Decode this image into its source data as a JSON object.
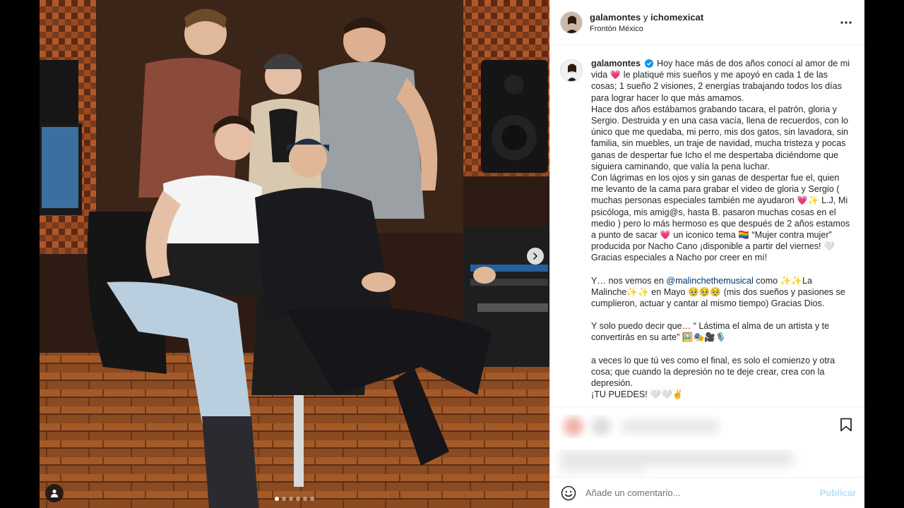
{
  "post": {
    "header": {
      "author": "galamontes",
      "joiner": "y",
      "coauthor": "ichomexicat",
      "location": "Frontón México"
    },
    "caption": {
      "username": "galamontes",
      "lines": [
        "Hoy hace más de dos años conocí al amor de mi vida 💗 le platiqué mis sueños y me apoyó en cada 1 de las cosas; 1 sueño 2 visiones, 2 energías trabajando todos los días para lograr hacer lo que más amamos.",
        "Hace dos años estábamos grabando tacara, el patrón, gloria y Sergio. Destruida y en una casa vacía, llena de recuerdos, con lo único que me quedaba, mi perro, mis dos gatos, sin lavadora, sin familia, sin muebles, un traje de navidad, mucha tristeza y pocas ganas de despertar fue Icho el me despertaba diciéndome que siguiera caminando, que valía la pena luchar.",
        "Con lágrimas en los ojos y sin ganas de despertar fue el, quien me levanto de la cama para grabar el video de gloria y Sergio ( muchas personas especiales también me ayudaron 💗✨ L.J, Mi psicóloga, mis amig@s, hasta B. pasaron muchas cosas en el medio ) pero lo más hermoso es que después de 2 años estamos a punto de sacar 💗 un iconico tema 🏳️‍🌈 “Mujer contra mujer” producida por Nacho Cano ¡disponible a partir del viernes! 🤍",
        "Gracias especiales a Nacho por creer en mí!",
        "",
        "Y… nos vemos en @malinchethemusical como ✨✨La Malinche✨✨ en Mayo 🥹🥹🥹 (mis dos sueños y pasiones se cumplieron, actuar y cantar al mismo tiempo) Gracias Dios.",
        "",
        "Y solo puedo decir que… “ Lástima el alma de un artista y te convertirás en su arte” 🖼️🎭🎥🎙️",
        "",
        "a veces lo que tú ves como el final, es solo el comienzo y otra cosa; que cuando la depresión no te deje crear, crea con la depresión.",
        "¡TU PUEDES! 🤍🤍✌️"
      ]
    },
    "comment": {
      "placeholder": "Añade un comentario...",
      "publish_label": "Publicar"
    },
    "carousel": {
      "dot_count": 6,
      "active_index": 0
    }
  },
  "icons": {
    "more": "more-options-icon",
    "verified": "verified-badge-icon",
    "bookmark": "bookmark-icon",
    "emoji": "emoji-icon",
    "next": "chevron-right-icon",
    "tag": "user-tag-icon"
  },
  "colors": {
    "mention": "#00376b",
    "publish_disabled": "#b2dffc",
    "verified": "#0095f6"
  }
}
